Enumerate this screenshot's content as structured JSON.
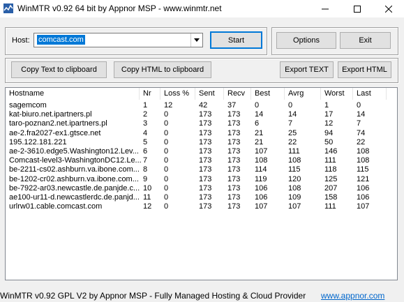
{
  "window": {
    "title": "WinMTR v0.92 64 bit by Appnor MSP - www.winmtr.net"
  },
  "host": {
    "label": "Host:",
    "value": "comcast.com"
  },
  "buttons": {
    "start": "Start",
    "options": "Options",
    "exit": "Exit",
    "copy_text": "Copy Text to clipboard",
    "copy_html": "Copy HTML to clipboard",
    "export_text": "Export TEXT",
    "export_html": "Export HTML"
  },
  "table": {
    "headers": [
      "Hostname",
      "Nr",
      "Loss %",
      "Sent",
      "Recv",
      "Best",
      "Avrg",
      "Worst",
      "Last"
    ],
    "rows": [
      [
        "sagemcom",
        "1",
        "12",
        "42",
        "37",
        "0",
        "0",
        "1",
        "0"
      ],
      [
        "kat-biuro.net.ipartners.pl",
        "2",
        "0",
        "173",
        "173",
        "14",
        "14",
        "17",
        "14"
      ],
      [
        "taro-poznan2.net.ipartners.pl",
        "3",
        "0",
        "173",
        "173",
        "6",
        "7",
        "12",
        "7"
      ],
      [
        "ae-2.fra2027-ex1.gtsce.net",
        "4",
        "0",
        "173",
        "173",
        "21",
        "25",
        "94",
        "74"
      ],
      [
        "195.122.181.221",
        "5",
        "0",
        "173",
        "173",
        "21",
        "22",
        "50",
        "22"
      ],
      [
        "ae-2-3610.edge5.Washington12.Lev...",
        "6",
        "0",
        "173",
        "173",
        "107",
        "111",
        "146",
        "108"
      ],
      [
        "Comcast-level3-WashingtonDC12.Le...",
        "7",
        "0",
        "173",
        "173",
        "108",
        "108",
        "111",
        "108"
      ],
      [
        "be-2211-cs02.ashburn.va.ibone.com...",
        "8",
        "0",
        "173",
        "173",
        "114",
        "115",
        "118",
        "115"
      ],
      [
        "be-1202-cr02.ashburn.va.ibone.com...",
        "9",
        "0",
        "173",
        "173",
        "119",
        "120",
        "125",
        "121"
      ],
      [
        "be-7922-ar03.newcastle.de.panjde.c...",
        "10",
        "0",
        "173",
        "173",
        "106",
        "108",
        "207",
        "106"
      ],
      [
        "ae100-ur11-d.newcastlerdc.de.panjd...",
        "11",
        "0",
        "173",
        "173",
        "106",
        "109",
        "158",
        "106"
      ],
      [
        "urlrw01.cable.comcast.com",
        "12",
        "0",
        "173",
        "173",
        "107",
        "107",
        "111",
        "107"
      ]
    ]
  },
  "status": {
    "text": "WinMTR v0.92 GPL V2 by Appnor MSP - Fully Managed Hosting & Cloud Provider",
    "link": "www.appnor.com"
  }
}
